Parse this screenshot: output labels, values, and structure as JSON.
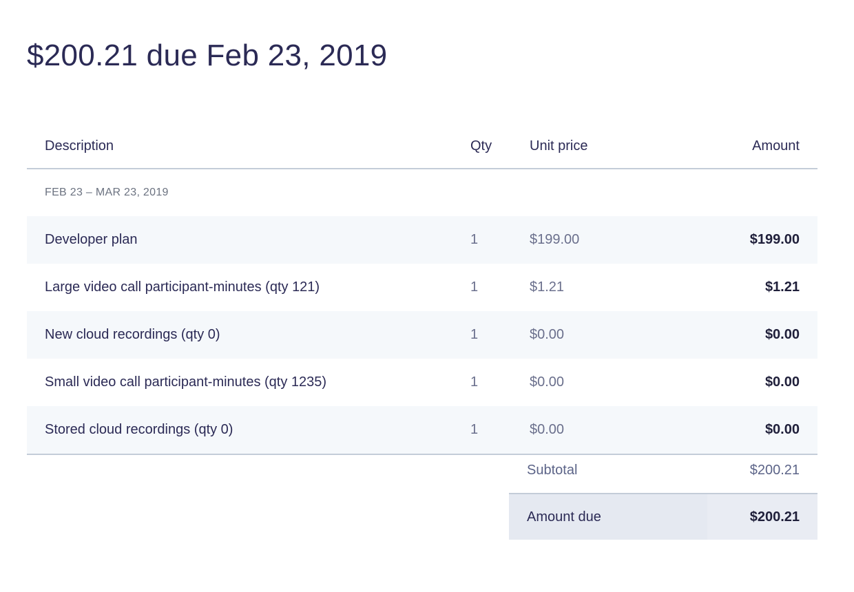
{
  "invoice": {
    "title": "$200.21 due Feb 23, 2019",
    "columns": {
      "description": "Description",
      "qty": "Qty",
      "unit_price": "Unit price",
      "amount": "Amount"
    },
    "period": "FEB 23 – MAR 23, 2019",
    "items": [
      {
        "description": "Developer plan",
        "qty": "1",
        "unit_price": "$199.00",
        "amount": "$199.00"
      },
      {
        "description": "Large video call participant-minutes (qty 121)",
        "qty": "1",
        "unit_price": "$1.21",
        "amount": "$1.21"
      },
      {
        "description": "New cloud recordings (qty 0)",
        "qty": "1",
        "unit_price": "$0.00",
        "amount": "$0.00"
      },
      {
        "description": "Small video call participant-minutes (qty 1235)",
        "qty": "1",
        "unit_price": "$0.00",
        "amount": "$0.00"
      },
      {
        "description": "Stored cloud recordings (qty 0)",
        "qty": "1",
        "unit_price": "$0.00",
        "amount": "$0.00"
      }
    ],
    "subtotal_label": "Subtotal",
    "subtotal_value": "$200.21",
    "amount_due_label": "Amount due",
    "amount_due_value": "$200.21"
  }
}
